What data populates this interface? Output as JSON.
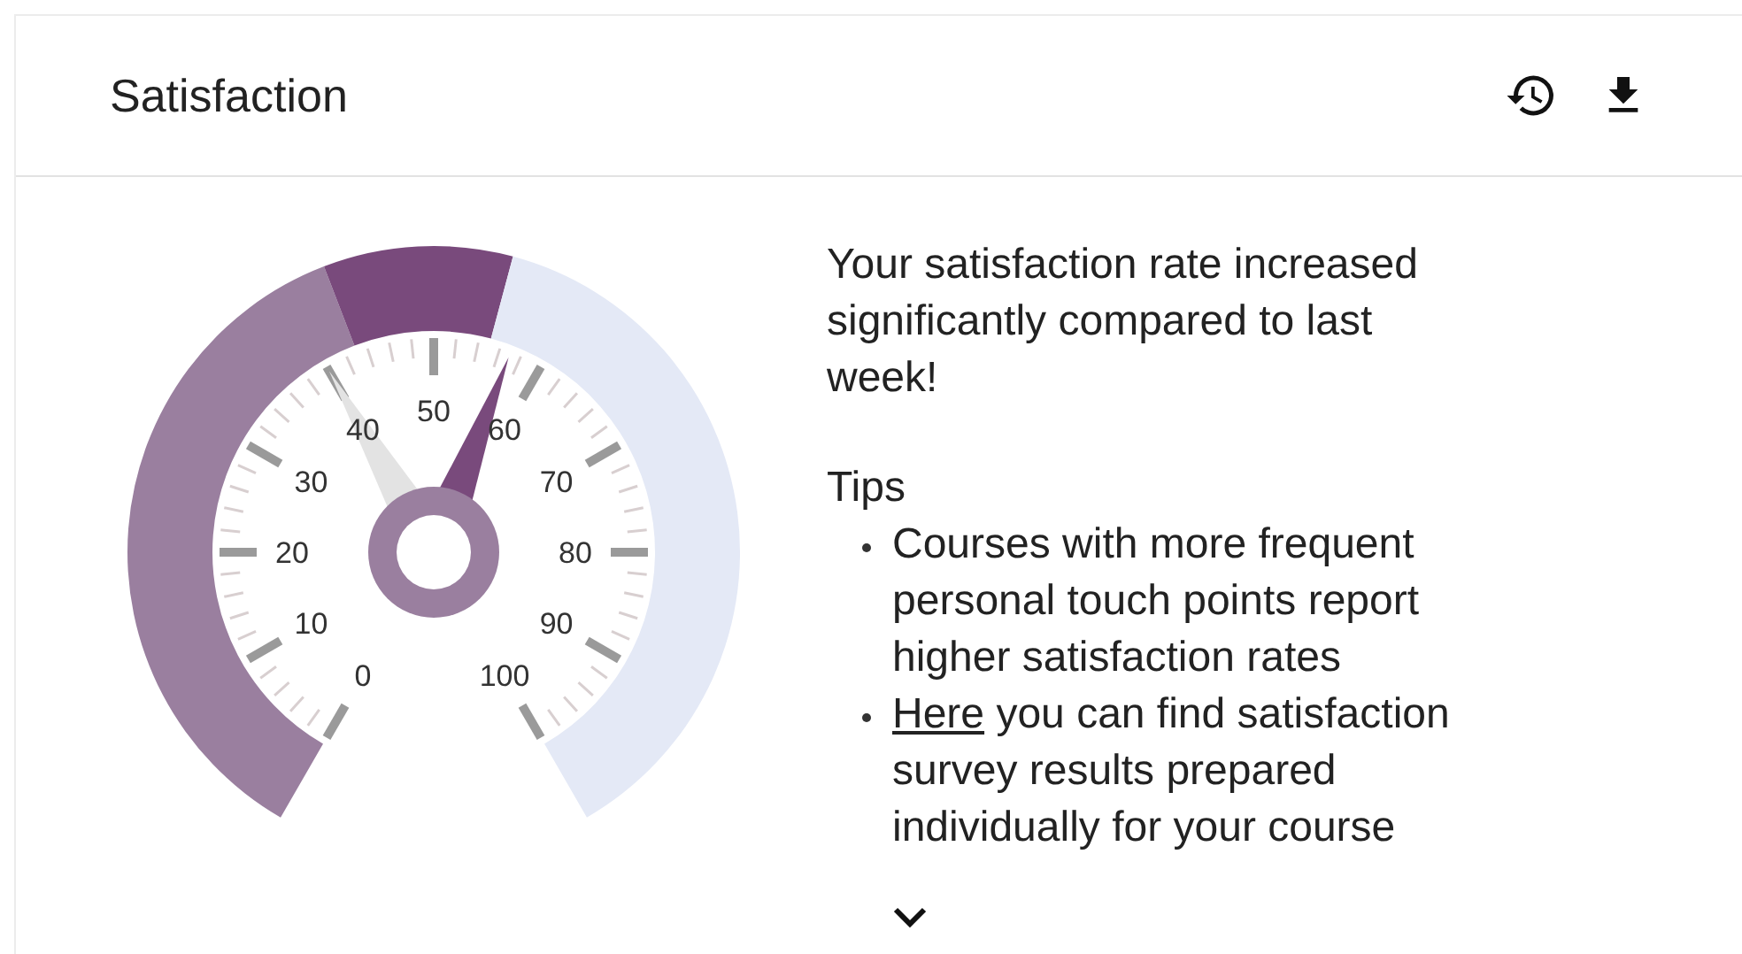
{
  "card": {
    "title": "Satisfaction",
    "actions": [
      {
        "kind": "history"
      },
      {
        "kind": "download"
      }
    ]
  },
  "gauge": {
    "labels": [
      "0",
      "10",
      "20",
      "30",
      "40",
      "50",
      "60",
      "70",
      "80",
      "90",
      "100"
    ],
    "bands": [
      {
        "color": "#9a7f9f"
      },
      {
        "color": "#794a7c"
      },
      {
        "color": "#e4e9f6"
      }
    ],
    "needles": [
      {
        "kind": "previous",
        "level": 0.4
      },
      {
        "kind": "current",
        "level": 0.57
      }
    ]
  },
  "message": "Your satisfaction rate increased significantly compared to last week!",
  "tips": {
    "heading": "Tips",
    "items": [
      {
        "kind": "text",
        "text": "Courses with more frequent personal touch points report higher satisfaction rates"
      },
      {
        "kind": "link",
        "link": "Here",
        "text": " you can find satisfaction survey results prepared individually for your course"
      }
    ]
  },
  "expand": {
    "expanded": false
  }
}
